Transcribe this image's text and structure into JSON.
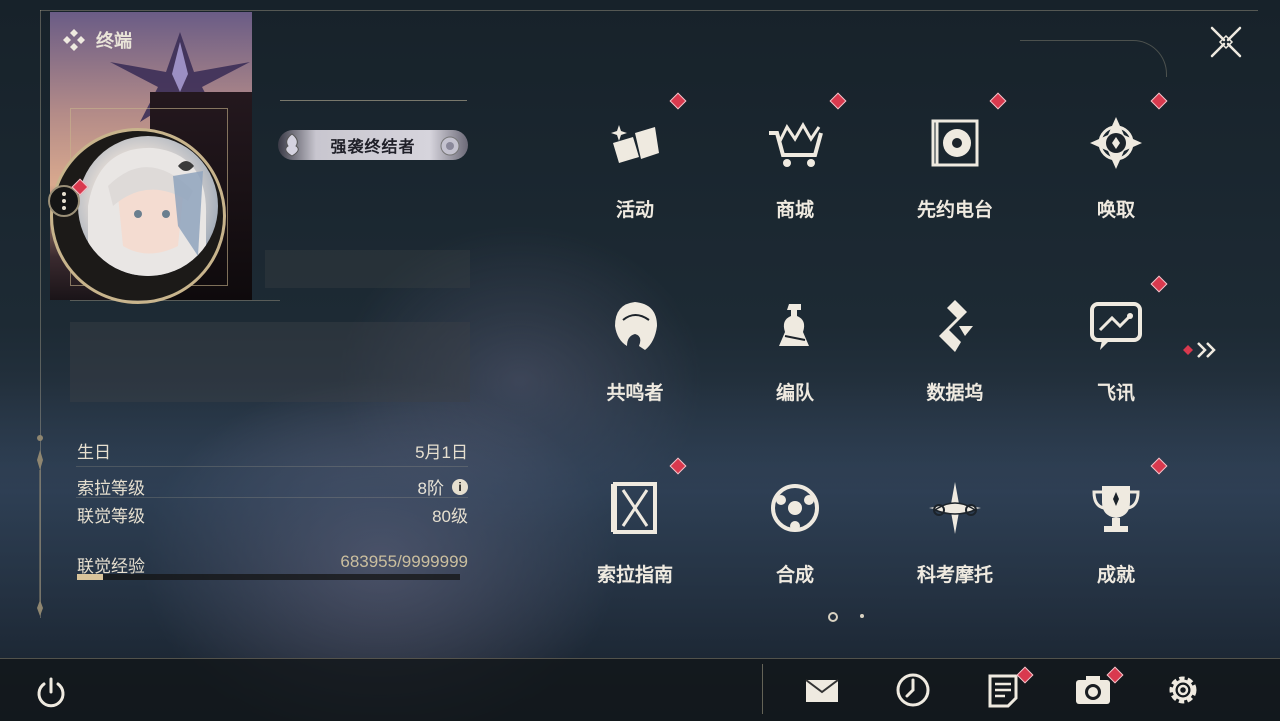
{
  "header": {
    "title": "终端"
  },
  "profile": {
    "title_badge": "强袭终结者"
  },
  "stats": [
    {
      "label": "生日",
      "value": "5月1日"
    },
    {
      "label": "索拉等级",
      "value": "8阶"
    },
    {
      "label": "联觉等级",
      "value": "80级"
    }
  ],
  "experience": {
    "label": "联觉经验",
    "value": "683955/9999999",
    "fraction": 0.068
  },
  "menu": [
    {
      "label": "活动",
      "icon": "activity-icon",
      "badge": true
    },
    {
      "label": "商城",
      "icon": "shop-cart-icon",
      "badge": true
    },
    {
      "label": "先约电台",
      "icon": "radio-icon",
      "badge": true
    },
    {
      "label": "唤取",
      "icon": "summon-compass-icon",
      "badge": true
    },
    {
      "label": "共鸣者",
      "icon": "resonator-head-icon",
      "badge": false
    },
    {
      "label": "编队",
      "icon": "chess-team-icon",
      "badge": false
    },
    {
      "label": "数据坞",
      "icon": "data-dock-icon",
      "badge": false
    },
    {
      "label": "飞讯",
      "icon": "message-chat-icon",
      "badge": true
    },
    {
      "label": "索拉指南",
      "icon": "guide-book-icon",
      "badge": true
    },
    {
      "label": "合成",
      "icon": "synthesis-icon",
      "badge": false
    },
    {
      "label": "科考摩托",
      "icon": "motorcycle-icon",
      "badge": false
    },
    {
      "label": "成就",
      "icon": "trophy-icon",
      "badge": true
    }
  ],
  "pagination": {
    "pages": 2,
    "current": 1
  },
  "bottom_bar": [
    {
      "icon": "mail-icon",
      "badge": false
    },
    {
      "icon": "clock-icon",
      "badge": false
    },
    {
      "icon": "notice-icon",
      "badge": true
    },
    {
      "icon": "camera-icon",
      "badge": true
    },
    {
      "icon": "settings-gear-icon",
      "badge": false
    }
  ],
  "colors": {
    "accent": "#d9c49b",
    "badge": "#d9394e",
    "text": "#efeae0"
  }
}
